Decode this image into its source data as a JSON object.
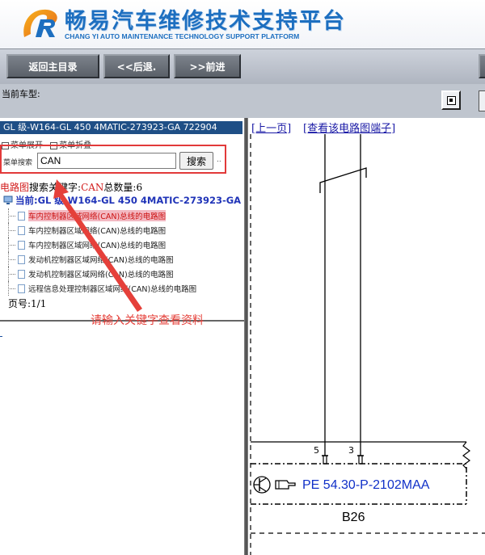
{
  "header": {
    "title": "畅易汽车维修技术支持平台",
    "subtitle": "CHANG YI AUTO MAINTENANCE TECHNOLOGY SUPPORT PLATFORM",
    "brand_color": "#1d6fc0"
  },
  "nav": {
    "home_label": "返回主目录",
    "back_label": "<<后退.",
    "forward_label": ">>前进"
  },
  "model": {
    "label": "当前车型:"
  },
  "left": {
    "vehicle_title": "GL 级-W164-GL 450 4MATIC-273923-GA 722904",
    "expand_label": "菜单展开",
    "collapse_label": "菜单折叠",
    "search_label": "菜单搜索",
    "search_value": "CAN",
    "search_button": "搜索",
    "search_dots": "..",
    "result_prefix": "电路图",
    "result_middle": "搜索关键字:",
    "result_keyword": "CAN",
    "result_count_label": "总数量:",
    "result_count": "6",
    "current_label": "当前:GL 级-W164-GL 450 4MATIC-273923-GA",
    "items": [
      {
        "label": "车内控制器区域网络(CAN)总线的电路图"
      },
      {
        "label": "车内控制器区域网络(CAN)总线的电路图"
      },
      {
        "label": "车内控制器区域网络(CAN)总线的电路图"
      },
      {
        "label": "发动机控制器区域网络(CAN)总线的电路图"
      },
      {
        "label": "发动机控制器区域网络(CAN)总线的电路图"
      },
      {
        "label": "远程信息处理控制器区域网络(CAN)总线的电路图"
      }
    ],
    "page_label": "页号:",
    "page_value": "1/1"
  },
  "annotation": {
    "text": "请输入关键字查看资料",
    "color": "#e5403a"
  },
  "right": {
    "prev_link": "[上一页]",
    "terminal_link": "[查看该电路图端子]",
    "pin_left": "5",
    "pin_right": "3",
    "component_code": "PE 54.30-P-2102MAA",
    "component_name": "B26"
  }
}
